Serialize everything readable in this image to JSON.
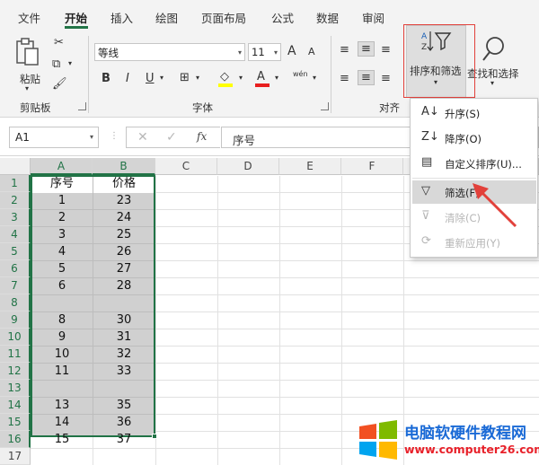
{
  "tabs": [
    "文件",
    "开始",
    "插入",
    "绘图",
    "页面布局",
    "公式",
    "数据",
    "审阅"
  ],
  "ribbon": {
    "clipboard": {
      "paste": "粘贴",
      "group": "剪贴板"
    },
    "font": {
      "name": "等线",
      "size": "11",
      "grow": "A",
      "shrink": "A",
      "phonetic": "wén",
      "bold": "B",
      "italic": "I",
      "underline": "U",
      "font_color": "A",
      "group": "字体"
    },
    "align": {
      "group": "对齐"
    },
    "sort_filter": {
      "label": "排序和筛选"
    },
    "find": {
      "label": "查找和选择"
    }
  },
  "formula_bar": {
    "name_box": "A1",
    "fx": "fx",
    "value": "序号"
  },
  "columns": [
    "A",
    "B",
    "C",
    "D",
    "E",
    "F"
  ],
  "rows": [
    "1",
    "2",
    "3",
    "4",
    "5",
    "6",
    "7",
    "8",
    "9",
    "10",
    "11",
    "12",
    "13",
    "14",
    "15",
    "16",
    "17"
  ],
  "cells": [
    [
      "序号",
      "价格"
    ],
    [
      "1",
      "23"
    ],
    [
      "2",
      "24"
    ],
    [
      "3",
      "25"
    ],
    [
      "4",
      "26"
    ],
    [
      "5",
      "27"
    ],
    [
      "6",
      "28"
    ],
    [
      "",
      ""
    ],
    [
      "8",
      "30"
    ],
    [
      "9",
      "31"
    ],
    [
      "10",
      "32"
    ],
    [
      "11",
      "33"
    ],
    [
      "",
      ""
    ],
    [
      "13",
      "35"
    ],
    [
      "14",
      "36"
    ],
    [
      "15",
      "37"
    ],
    [
      "",
      ""
    ]
  ],
  "menu": [
    {
      "label": "升序(S)",
      "icon": "sort-ascending-icon"
    },
    {
      "label": "降序(O)",
      "icon": "sort-descending-icon"
    },
    {
      "label": "自定义排序(U)...",
      "icon": "custom-sort-icon"
    },
    {
      "label": "筛选(F)",
      "icon": "filter-icon"
    },
    {
      "label": "清除(C)",
      "icon": "clear-filter-icon"
    },
    {
      "label": "重新应用(Y)",
      "icon": "reapply-filter-icon"
    }
  ],
  "watermark": {
    "title": "电脑软硬件教程网",
    "url": "www.computer26.com"
  },
  "colors": {
    "accent": "#217346",
    "highlight_box": "#e2413b",
    "selection": "#d0d0d0"
  }
}
